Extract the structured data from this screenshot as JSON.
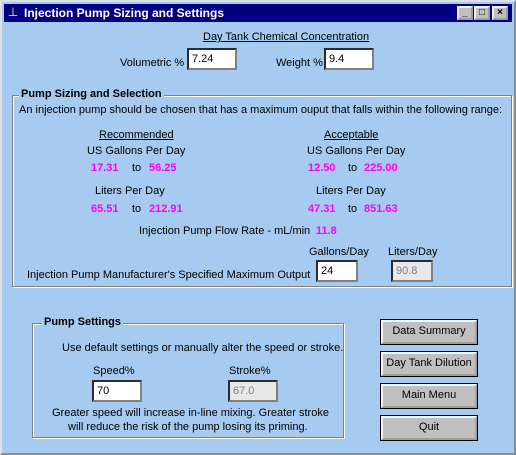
{
  "window": {
    "title": "Injection Pump Sizing and Settings",
    "min_glyph": "_",
    "max_glyph": "□",
    "close_glyph": "×"
  },
  "concentration": {
    "heading": "Day Tank Chemical Concentration",
    "volumetric_label": "Volumetric %",
    "volumetric_value": "7.24",
    "weight_label": "Weight %",
    "weight_value": "9.4"
  },
  "sizing": {
    "group_title": "Pump Sizing and Selection",
    "intro": "An injection pump should be chosen that has a maximum ouput that falls within the following range:",
    "recommended": {
      "heading": "Recommended",
      "gpd_label": "US Gallons Per Day",
      "gpd_min": "17.31",
      "gpd_max": "56.25",
      "lpd_label": "Liters Per Day",
      "lpd_min": "65.51",
      "lpd_max": "212.91"
    },
    "acceptable": {
      "heading": "Acceptable",
      "gpd_label": "US Gallons Per Day",
      "gpd_min": "12.50",
      "gpd_max": "225.00",
      "lpd_label": "Liters Per Day",
      "lpd_min": "47.31",
      "lpd_max": "851.63"
    },
    "to_word": "to",
    "flow_rate_label": "Injection Pump Flow Rate - mL/min",
    "flow_rate_value": "11.8",
    "gallons_col_label": "Gallons/Day",
    "liters_col_label": "Liters/Day",
    "max_output_label": "Injection Pump Manufacturer's Specified Maximum Output",
    "max_output_gallons": "24",
    "max_output_liters": "90.8"
  },
  "settings": {
    "group_title": "Pump Settings",
    "intro": "Use default settings or manually alter the speed or stroke.",
    "speed_label": "Speed%",
    "speed_value": "70",
    "stroke_label": "Stroke%",
    "stroke_value": "67.0",
    "note_line1": "Greater speed will increase in-line mixing.  Greater stroke",
    "note_line2": "will reduce the risk of the pump losing its priming."
  },
  "buttons": {
    "data_summary": "Data Summary",
    "day_tank_dilution": "Day Tank Dilution",
    "main_menu": "Main Menu",
    "quit": "Quit"
  },
  "colors": {
    "background": "#a6caf0",
    "titlebar": "#000080",
    "highlight_value": "#ff00ff"
  }
}
